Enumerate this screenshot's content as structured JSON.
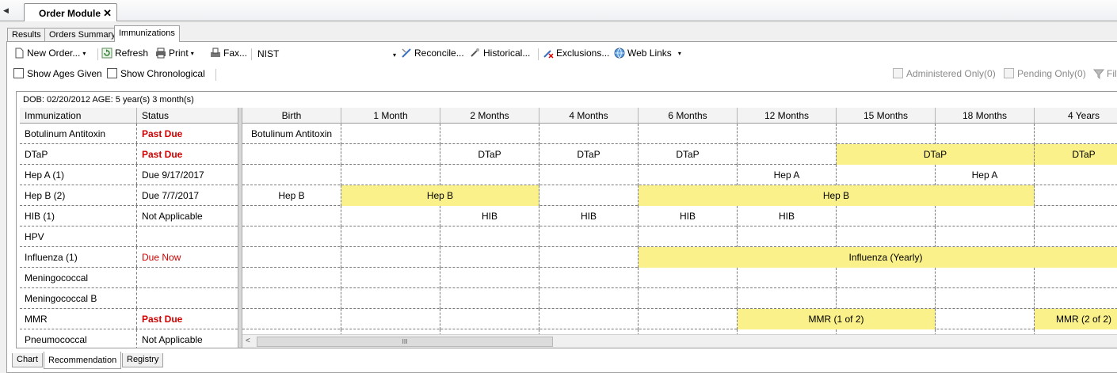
{
  "document_tab": {
    "label": "Order Module",
    "close": "✕",
    "scroll_left": "◀"
  },
  "sub_tabs": [
    "Results",
    "Orders Summary",
    "Immunizations"
  ],
  "toolbar": {
    "new_order": "New Order...",
    "refresh": "Refresh",
    "print": "Print",
    "fax": "Fax...",
    "nist": "NIST",
    "reconcile": "Reconcile...",
    "historical": "Historical...",
    "exclusions": "Exclusions...",
    "web_links": "Web Links"
  },
  "options": {
    "show_ages_given": "Show Ages Given",
    "show_chronological": "Show Chronological",
    "administered_only": "Administered Only(0)",
    "pending_only": "Pending Only(0)",
    "filter": "Fil"
  },
  "patient": {
    "dob_line": "DOB: 02/20/2012 AGE: 5 year(s) 3 month(s)"
  },
  "grid": {
    "col_immunization": "Immunization",
    "col_status": "Status",
    "age_columns": [
      "Birth",
      "1 Month",
      "2 Months",
      "4 Months",
      "6 Months",
      "12 Months",
      "15 Months",
      "18 Months",
      "4 Years"
    ],
    "rows": [
      {
        "name": "Botulinum Antitoxin",
        "status": "Past Due",
        "status_type": "pastdue"
      },
      {
        "name": "DTaP",
        "status": "Past Due",
        "status_type": "pastdue"
      },
      {
        "name": "Hep A (1)",
        "status": "Due 9/17/2017",
        "status_type": "normal"
      },
      {
        "name": "Hep B (2)",
        "status": "Due 7/7/2017",
        "status_type": "normal"
      },
      {
        "name": "HIB (1)",
        "status": "Not Applicable",
        "status_type": "normal"
      },
      {
        "name": "HPV",
        "status": "",
        "status_type": "normal"
      },
      {
        "name": "Influenza (1)",
        "status": "Due Now",
        "status_type": "duenow"
      },
      {
        "name": "Meningococcal",
        "status": "",
        "status_type": "normal"
      },
      {
        "name": "Meningococcal B",
        "status": "",
        "status_type": "normal"
      },
      {
        "name": "MMR",
        "status": "Past Due",
        "status_type": "pastdue"
      },
      {
        "name": "Pneumococcal",
        "status": "Not Applicable",
        "status_type": "normal"
      }
    ],
    "schedule": [
      [
        {
          "start": 0,
          "span": 1,
          "label": "Botulinum Antitoxin",
          "hl": false
        }
      ],
      [
        {
          "start": 2,
          "span": 1,
          "label": "DTaP",
          "hl": false
        },
        {
          "start": 3,
          "span": 1,
          "label": "DTaP",
          "hl": false
        },
        {
          "start": 4,
          "span": 1,
          "label": "DTaP",
          "hl": false
        },
        {
          "start": 6,
          "span": 2,
          "label": "DTaP",
          "hl": true
        },
        {
          "start": 8,
          "span": 1,
          "label": "DTaP",
          "hl": true
        }
      ],
      [
        {
          "start": 5,
          "span": 1,
          "label": "Hep A",
          "hl": false
        },
        {
          "start": 7,
          "span": 1,
          "label": "Hep A",
          "hl": false
        }
      ],
      [
        {
          "start": 0,
          "span": 1,
          "label": "Hep B",
          "hl": false
        },
        {
          "start": 1,
          "span": 2,
          "label": "Hep B",
          "hl": true
        },
        {
          "start": 4,
          "span": 4,
          "label": "Hep B",
          "hl": true
        }
      ],
      [
        {
          "start": 2,
          "span": 1,
          "label": "HIB",
          "hl": false
        },
        {
          "start": 3,
          "span": 1,
          "label": "HIB",
          "hl": false
        },
        {
          "start": 4,
          "span": 1,
          "label": "HIB",
          "hl": false
        },
        {
          "start": 5,
          "span": 1,
          "label": "HIB",
          "hl": false
        }
      ],
      [],
      [
        {
          "start": 4,
          "span": 5,
          "label": "Influenza (Yearly)",
          "hl": true
        }
      ],
      [],
      [],
      [
        {
          "start": 5,
          "span": 2,
          "label": "MMR (1 of 2)",
          "hl": true
        },
        {
          "start": 8,
          "span": 1,
          "label": "MMR (2 of 2)",
          "hl": true
        }
      ],
      []
    ],
    "scroll_thumb": "III",
    "scroll_left": "<"
  },
  "bottom_tabs": [
    "Chart",
    "Recommendation",
    "Registry"
  ],
  "colors": {
    "highlight": "#faf18a",
    "past_due": "#d00000"
  }
}
